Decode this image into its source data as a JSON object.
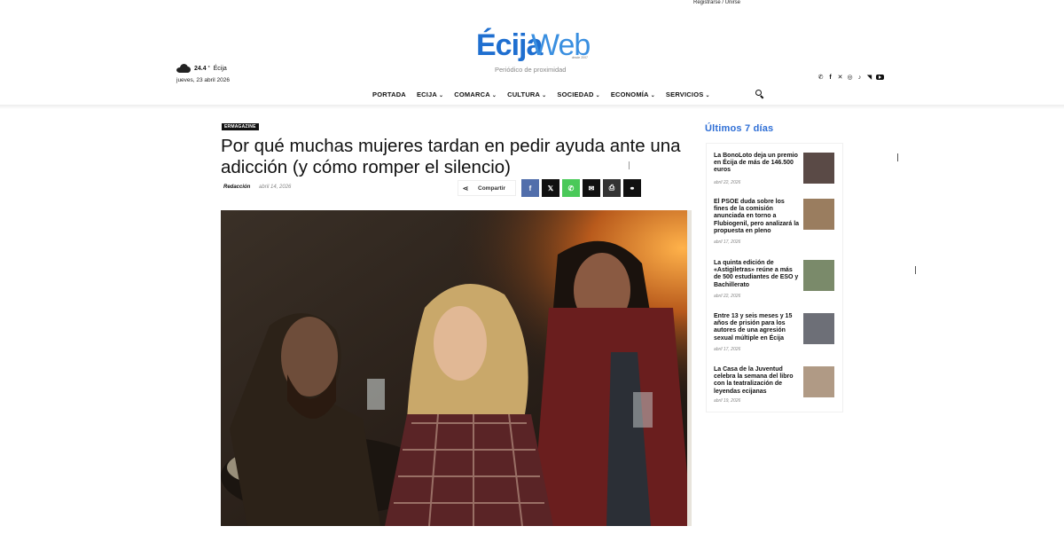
{
  "topbar": {
    "register_login": "Registrarse / Unirse"
  },
  "weather": {
    "temperature": "24.4",
    "unit": "°",
    "city": "Écija",
    "icon": "cloud-icon"
  },
  "date": "jueves, 23 abril 2026",
  "logo": {
    "part1": "Écija",
    "part2": "Web",
    "since": "desde 2007"
  },
  "tagline": "Periódico de proximidad",
  "social": [
    "whatsapp-icon",
    "facebook-icon",
    "x-icon",
    "instagram-icon",
    "tiktok-icon",
    "rss-icon",
    "youtube-icon"
  ],
  "nav": [
    {
      "label": "PORTADA",
      "dropdown": false
    },
    {
      "label": "ECIJA",
      "dropdown": true
    },
    {
      "label": "COMARCA",
      "dropdown": true
    },
    {
      "label": "CULTURA",
      "dropdown": true
    },
    {
      "label": "SOCIEDAD",
      "dropdown": true
    },
    {
      "label": "ECONOMÍA",
      "dropdown": true
    },
    {
      "label": "SERVICIOS",
      "dropdown": true
    }
  ],
  "article": {
    "category": "ERMAGAZINE",
    "title": "Por qué muchas mujeres tardan en pedir ayuda ante una adicción (y cómo romper el silencio)",
    "author": "Redacción",
    "date": "abril 14, 2026",
    "share_label": "Compartir",
    "share_buttons": [
      {
        "icon": "facebook-icon",
        "glyph": "f",
        "color": "#516eab"
      },
      {
        "icon": "x-icon",
        "glyph": "𝕏",
        "color": "#111111"
      },
      {
        "icon": "whatsapp-icon",
        "glyph": "✆",
        "color": "#4ac959"
      },
      {
        "icon": "email-icon",
        "glyph": "✉",
        "color": "#111111"
      },
      {
        "icon": "print-icon",
        "glyph": "⎙",
        "color": "#333333"
      },
      {
        "icon": "copy-link-icon",
        "glyph": "⚭",
        "color": "#111111"
      }
    ]
  },
  "sidebar": {
    "heading": "Últimos 7 días",
    "items": [
      {
        "title": "La BonoLoto deja un premio en Écija de más de 146.500 euros",
        "date": "abril 22, 2026",
        "thumb": "#5a4a46"
      },
      {
        "title": "El PSOE duda sobre los fines de la comisión anunciada en torno a Flubiogenil, pero analizará la propuesta en pleno",
        "date": "abril 17, 2026",
        "thumb": "#9a7d5f"
      },
      {
        "title": "La quinta edición de «Astigiletras» reúne a más de 500 estudiantes de ESO y Bachillerato",
        "date": "abril 22, 2026",
        "thumb": "#7a8a6a"
      },
      {
        "title": "Entre 13 y seis meses y 15 años de prisión para los autores de una agresión sexual múltiple en Écija",
        "date": "abril 17, 2026",
        "thumb": "#6d6f77"
      },
      {
        "title": "La Casa de la Juventud celebra la semana del libro con la teatralización de leyendas ecijanas",
        "date": "abril 19, 2026",
        "thumb": "#b09a85"
      }
    ]
  }
}
